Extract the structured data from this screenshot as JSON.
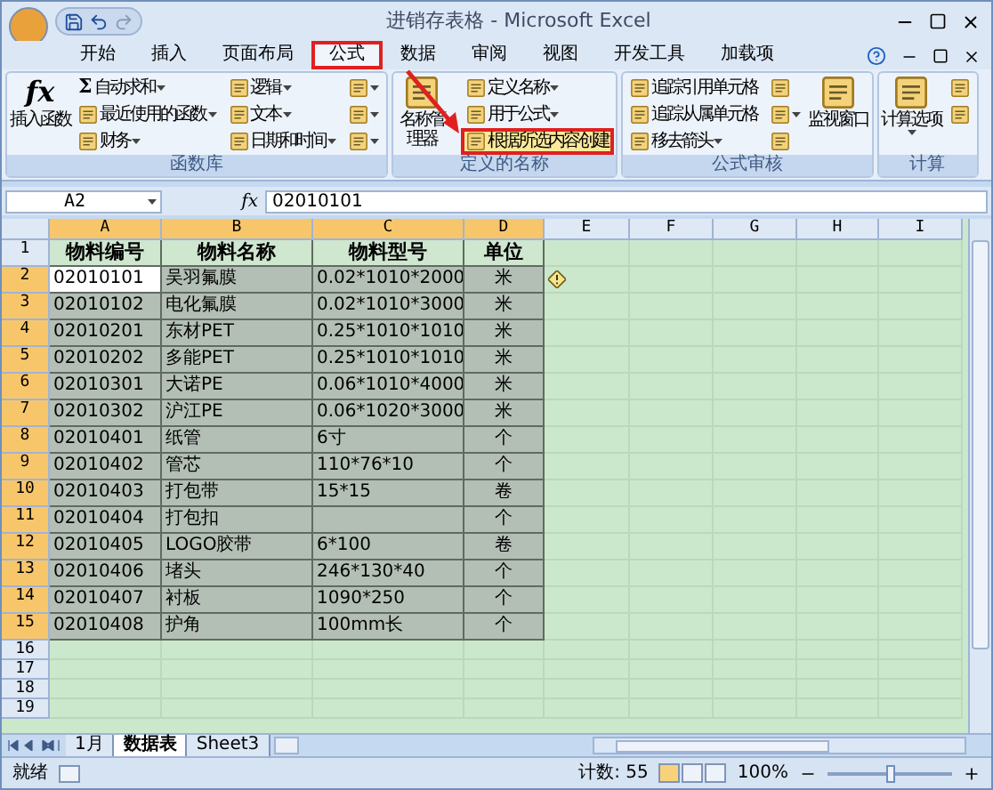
{
  "window": {
    "title": "进销存表格 - Microsoft Excel"
  },
  "tabs": [
    {
      "label": "开始",
      "selected": false,
      "highlighted": false
    },
    {
      "label": "插入",
      "selected": false,
      "highlighted": false
    },
    {
      "label": "页面布局",
      "selected": false,
      "highlighted": false
    },
    {
      "label": "公式",
      "selected": true,
      "highlighted": true
    },
    {
      "label": "数据",
      "selected": false,
      "highlighted": false
    },
    {
      "label": "审阅",
      "selected": false,
      "highlighted": false
    },
    {
      "label": "视图",
      "selected": false,
      "highlighted": false
    },
    {
      "label": "开发工具",
      "selected": false,
      "highlighted": false
    },
    {
      "label": "加载项",
      "selected": false,
      "highlighted": false
    }
  ],
  "ribbon": {
    "groups": [
      {
        "label": "函数库",
        "columns": [
          {
            "kind": "large",
            "label": "插入函数",
            "glyph": "fx",
            "dropdown": false
          },
          {
            "kind": "stack",
            "items": [
              {
                "label": "自动求和",
                "glyph": "Σ",
                "dropdown": true,
                "highlighted": false
              },
              {
                "label": "最近使用的函数",
                "dropdown": true,
                "highlighted": false
              },
              {
                "label": "财务",
                "dropdown": true,
                "highlighted": false
              }
            ]
          },
          {
            "kind": "stack",
            "items": [
              {
                "label": "逻辑",
                "dropdown": true,
                "highlighted": false
              },
              {
                "label": "文本",
                "dropdown": true,
                "highlighted": false
              },
              {
                "label": "日期和时间",
                "dropdown": true,
                "highlighted": false
              }
            ]
          },
          {
            "kind": "stack",
            "items": [
              {
                "dropdown": true,
                "highlighted": false
              },
              {
                "dropdown": true,
                "highlighted": false
              },
              {
                "dropdown": true,
                "highlighted": false
              }
            ]
          }
        ]
      },
      {
        "label": "定义的名称",
        "columns": [
          {
            "kind": "large",
            "label": "名称管理器",
            "dropdown": false
          },
          {
            "kind": "stack",
            "items": [
              {
                "label": "定义名称",
                "dropdown": true,
                "highlighted": false
              },
              {
                "label": "用于公式",
                "dropdown": true,
                "highlighted": false
              },
              {
                "label": "根据所选内容创建",
                "dropdown": false,
                "highlighted": true
              }
            ]
          }
        ]
      },
      {
        "label": "公式审核",
        "columns": [
          {
            "kind": "stack",
            "items": [
              {
                "label": "追踪引用单元格",
                "dropdown": false,
                "highlighted": false
              },
              {
                "label": "追踪从属单元格",
                "dropdown": false,
                "highlighted": false
              },
              {
                "label": "移去箭头",
                "dropdown": true,
                "highlighted": false
              }
            ]
          },
          {
            "kind": "stack",
            "items": [
              {
                "dropdown": false,
                "highlighted": false
              },
              {
                "dropdown": true,
                "highlighted": false
              },
              {
                "dropdown": false,
                "highlighted": false
              }
            ]
          },
          {
            "kind": "large",
            "label": "监视窗口",
            "dropdown": false
          }
        ]
      },
      {
        "label": "计算",
        "columns": [
          {
            "kind": "large",
            "label": "计算选项",
            "dropdown": true
          },
          {
            "kind": "stack",
            "items": [
              {
                "dropdown": false,
                "highlighted": false
              },
              {
                "dropdown": false,
                "highlighted": false
              }
            ]
          }
        ]
      }
    ]
  },
  "formula_bar": {
    "name_box": "A2",
    "fx": "fx",
    "value": "02010101"
  },
  "columns": [
    {
      "label": "A",
      "selected": true
    },
    {
      "label": "B",
      "selected": true
    },
    {
      "label": "C",
      "selected": true
    },
    {
      "label": "D",
      "selected": true
    },
    {
      "label": "E",
      "selected": false
    },
    {
      "label": "F",
      "selected": false
    },
    {
      "label": "G",
      "selected": false
    },
    {
      "label": "H",
      "selected": false
    },
    {
      "label": "I",
      "selected": false
    }
  ],
  "rows": [
    {
      "number": "1",
      "selected": false,
      "header": true,
      "cells": {
        "A": "物料编号",
        "B": "物料名称",
        "C": "物料型号",
        "D": "单位"
      }
    },
    {
      "number": "2",
      "selected": true,
      "active": true,
      "cells": {
        "A": "02010101",
        "B": "吴羽氟膜",
        "C": "0.02*1010*2000",
        "D": "米"
      }
    },
    {
      "number": "3",
      "selected": true,
      "cells": {
        "A": "02010102",
        "B": "电化氟膜",
        "C": "0.02*1010*3000",
        "D": "米"
      }
    },
    {
      "number": "4",
      "selected": true,
      "cells": {
        "A": "02010201",
        "B": "东材PET",
        "C": "0.25*1010*1010",
        "D": "米"
      }
    },
    {
      "number": "5",
      "selected": true,
      "cells": {
        "A": "02010202",
        "B": "多能PET",
        "C": "0.25*1010*1010",
        "D": "米"
      }
    },
    {
      "number": "6",
      "selected": true,
      "cells": {
        "A": "02010301",
        "B": "大诺PE",
        "C": "0.06*1010*4000",
        "D": "米"
      }
    },
    {
      "number": "7",
      "selected": true,
      "cells": {
        "A": "02010302",
        "B": "沪江PE",
        "C": "0.06*1020*3000",
        "D": "米"
      }
    },
    {
      "number": "8",
      "selected": true,
      "cells": {
        "A": "02010401",
        "B": "纸管",
        "C": "6寸",
        "D": "个"
      }
    },
    {
      "number": "9",
      "selected": true,
      "cells": {
        "A": "02010402",
        "B": "管芯",
        "C": "110*76*10",
        "D": "个"
      }
    },
    {
      "number": "10",
      "selected": true,
      "cells": {
        "A": "02010403",
        "B": "打包带",
        "C": "15*15",
        "D": "卷"
      }
    },
    {
      "number": "11",
      "selected": true,
      "cells": {
        "A": "02010404",
        "B": "打包扣",
        "D": "个"
      }
    },
    {
      "number": "12",
      "selected": true,
      "cells": {
        "A": "02010405",
        "B": "LOGO胶带",
        "C": "6*100",
        "D": "卷"
      }
    },
    {
      "number": "13",
      "selected": true,
      "cells": {
        "A": "02010406",
        "B": "堵头",
        "C": "246*130*40",
        "D": "个"
      }
    },
    {
      "number": "14",
      "selected": true,
      "cells": {
        "A": "02010407",
        "B": "衬板",
        "C": "1090*250",
        "D": "个"
      }
    },
    {
      "number": "15",
      "selected": true,
      "cells": {
        "A": "02010408",
        "B": "护角",
        "C": "100mm长",
        "D": "个"
      }
    },
    {
      "number": "16",
      "selected": false
    },
    {
      "number": "17",
      "selected": false
    },
    {
      "number": "18",
      "selected": false
    },
    {
      "number": "19",
      "selected": false
    }
  ],
  "sheet_tabs": [
    {
      "label": "1月",
      "selected": false
    },
    {
      "label": "数据表",
      "selected": true
    },
    {
      "label": "Sheet3",
      "selected": false
    }
  ],
  "status_bar": {
    "state": "就绪",
    "count": "计数: 55",
    "zoom": "100%",
    "zoom_level": {
      "level": 0.5
    },
    "views": [
      {
        "selected": true
      },
      {
        "selected": false
      },
      {
        "selected": false
      }
    ]
  }
}
